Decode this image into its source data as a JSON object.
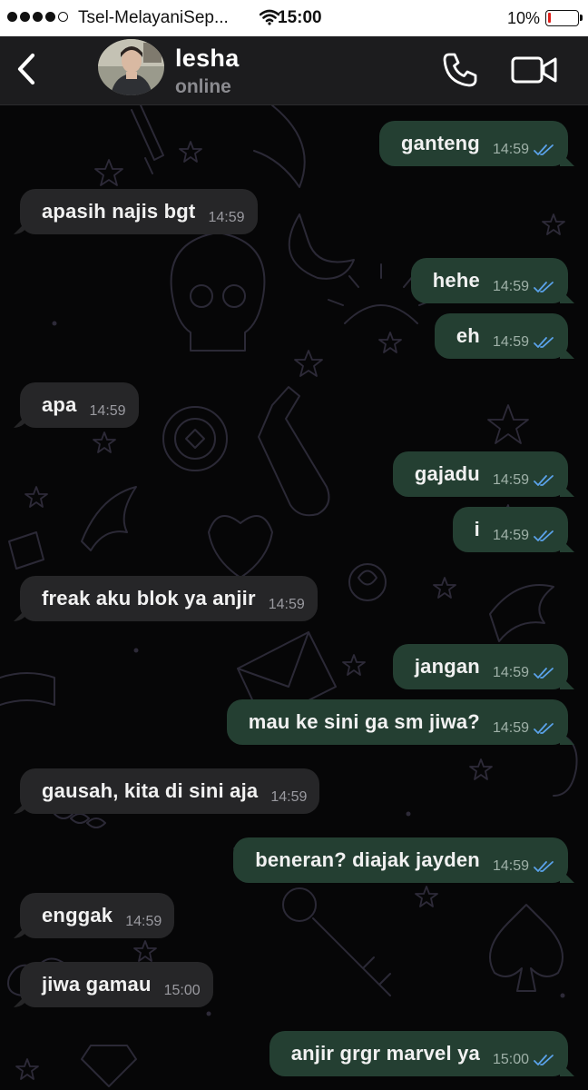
{
  "status_bar": {
    "carrier": "Tsel-MelayaniSep...",
    "time": "15:00",
    "battery_percent": "10%",
    "battery_level": 0.1,
    "battery_color": "#e0201b",
    "signal_icon": "signal-dots-icon",
    "wifi_icon": "wifi-icon"
  },
  "header": {
    "back_icon": "chevron-left-icon",
    "contact_name": "lesha",
    "contact_status": "online",
    "call_icon": "phone-icon",
    "video_icon": "video-camera-icon"
  },
  "colors": {
    "incoming_bubble": "#262628",
    "outgoing_bubble": "#243f32",
    "read_tick": "#5aa2ea",
    "wallpaper_doodle": "#2b2936"
  },
  "messages": [
    {
      "dir": "out",
      "text": "ganteng",
      "time": "14:59",
      "read": true
    },
    {
      "dir": "in",
      "text": "apasih najis bgt",
      "time": "14:59"
    },
    {
      "dir": "out",
      "text": "hehe",
      "time": "14:59",
      "read": true
    },
    {
      "dir": "out",
      "text": "eh",
      "time": "14:59",
      "read": true
    },
    {
      "dir": "in",
      "text": "apa",
      "time": "14:59"
    },
    {
      "dir": "out",
      "text": "gajadu",
      "time": "14:59",
      "read": true
    },
    {
      "dir": "out",
      "text": "i",
      "time": "14:59",
      "read": true
    },
    {
      "dir": "in",
      "text": "freak aku blok ya anjir",
      "time": "14:59"
    },
    {
      "dir": "out",
      "text": "jangan",
      "time": "14:59",
      "read": true
    },
    {
      "dir": "out",
      "text": "mau ke sini ga sm jiwa?",
      "time": "14:59",
      "read": true
    },
    {
      "dir": "in",
      "text": "gausah, kita di sini aja",
      "time": "14:59"
    },
    {
      "dir": "out",
      "text": "beneran? diajak jayden",
      "time": "14:59",
      "read": true
    },
    {
      "dir": "in",
      "text": "enggak",
      "time": "14:59"
    },
    {
      "dir": "in",
      "text": "jiwa gamau",
      "time": "15:00"
    },
    {
      "dir": "out",
      "text": "anjir grgr marvel ya",
      "time": "15:00",
      "read": true
    }
  ]
}
